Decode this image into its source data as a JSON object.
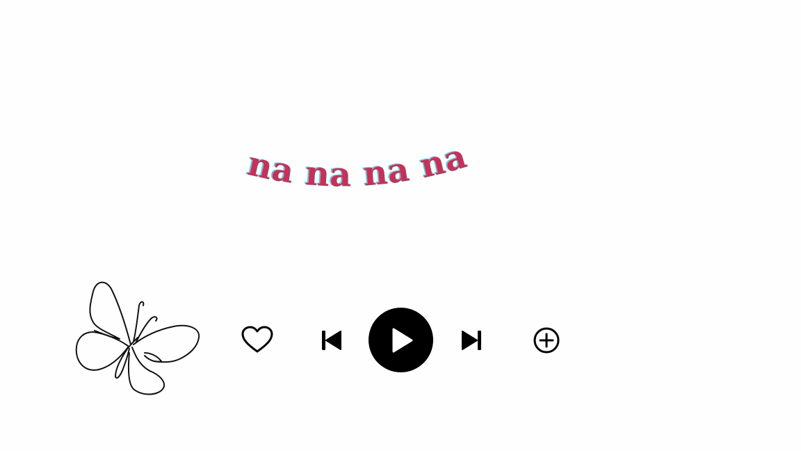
{
  "lyric": {
    "text": "na na na na",
    "color": "#c7305a",
    "shadow_color": "#4fd3d8"
  },
  "decoration": {
    "icon": "butterfly-line-drawing"
  },
  "player": {
    "like_icon": "heart-outline",
    "previous_icon": "skip-previous",
    "play_icon": "play",
    "next_icon": "skip-next",
    "add_icon": "circle-plus",
    "icon_color": "#000000",
    "play_button_color": "#000000",
    "play_icon_color": "#ffffff"
  }
}
